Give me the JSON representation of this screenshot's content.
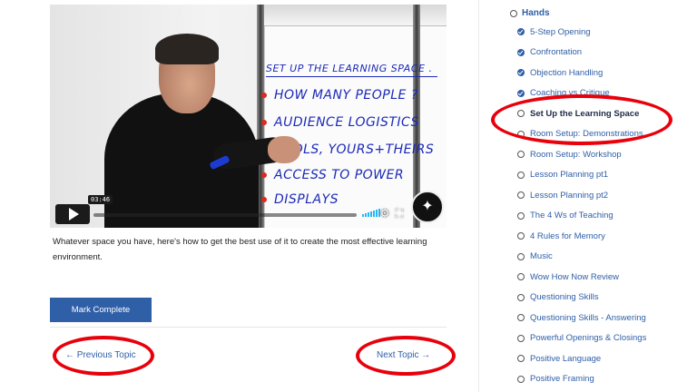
{
  "video": {
    "timecode": "03:46",
    "flipchart": {
      "title": "SET UP THE LEARNING SPACE .",
      "lines": [
        "HOW MANY PEOPLE ?",
        "AUDIENCE LOGISTICS",
        "TOOLS, YOURS+THEIRS",
        "ACCESS TO POWER",
        "DISPLAYS"
      ]
    },
    "icons": {
      "play": "play-icon",
      "volume": "volume-icon",
      "settings": "gear-icon",
      "fullscreen": "fullscreen-icon",
      "badge": "compass-logo-icon"
    }
  },
  "description": "Whatever space you have, here's how to get the best use of it to create the most effective learning environment.",
  "mark_complete_label": "Mark Complete",
  "nav": {
    "previous": "← Previous Topic",
    "next": "Next Topic →"
  },
  "sidebar": {
    "section_title": "Hands",
    "topics": [
      {
        "label": "5-Step Opening",
        "status": "complete"
      },
      {
        "label": "Confrontation",
        "status": "complete"
      },
      {
        "label": "Objection Handling",
        "status": "complete"
      },
      {
        "label": "Coaching vs Critique",
        "status": "complete"
      },
      {
        "label": "Set Up the Learning Space",
        "status": "current"
      },
      {
        "label": "Room Setup: Demonstrations",
        "status": "incomplete"
      },
      {
        "label": "Room Setup: Workshop",
        "status": "incomplete"
      },
      {
        "label": "Lesson Planning pt1",
        "status": "incomplete"
      },
      {
        "label": "Lesson Planning pt2",
        "status": "incomplete"
      },
      {
        "label": "The 4 Ws of Teaching",
        "status": "incomplete"
      },
      {
        "label": "4 Rules for Memory",
        "status": "incomplete"
      },
      {
        "label": "Music",
        "status": "incomplete"
      },
      {
        "label": "Wow How Now Review",
        "status": "incomplete"
      },
      {
        "label": "Questioning Skills",
        "status": "incomplete"
      },
      {
        "label": "Questioning Skills - Answering",
        "status": "incomplete"
      },
      {
        "label": "Powerful Openings & Closings",
        "status": "incomplete"
      },
      {
        "label": "Positive Language",
        "status": "incomplete"
      },
      {
        "label": "Positive Framing",
        "status": "incomplete"
      }
    ]
  },
  "colors": {
    "accent": "#2f5fa7",
    "annotation": "#e8000b",
    "check": "#2f5fa7"
  }
}
